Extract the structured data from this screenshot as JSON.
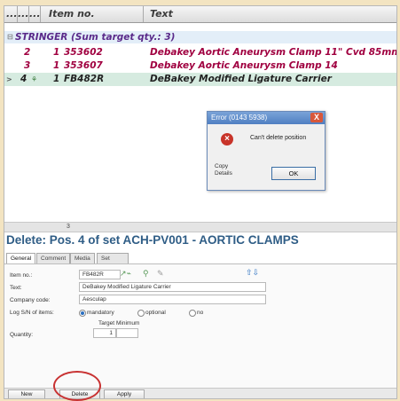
{
  "grid": {
    "headers": [
      "...",
      "...",
      "...",
      "Item no.",
      "Text"
    ],
    "group_label": "STRINGER (Sum target qty.: 3)",
    "rows": [
      {
        "pos": "2",
        "qty": "1",
        "item": "353602",
        "text": "Debakey Aortic Aneurysm Clamp 11\" Cvd 85mm",
        "selected": false
      },
      {
        "pos": "3",
        "qty": "1",
        "item": "353607",
        "text": "Debakey Aortic Aneurysm Clamp 14",
        "selected": false
      },
      {
        "pos": "4",
        "qty": "1",
        "item": "FB482R",
        "text": "DeBakey Modified Ligature Carrier",
        "selected": true
      }
    ],
    "row_marker": ">",
    "footer_value": "3"
  },
  "dialog": {
    "title": "Error (0143 5938)",
    "close_glyph": "X",
    "icon_glyph": "×",
    "message": "Can't delete position",
    "copy_details_1": "Copy",
    "copy_details_2": "Details",
    "ok_label": "OK"
  },
  "panel": {
    "title": "Delete: Pos. 4 of set ACH-PV001 - AORTIC CLAMPS",
    "tabs": [
      "General",
      "Comment",
      "Media",
      "Set positions"
    ],
    "fields": {
      "item_no_label": "Item no.:",
      "item_no_value": "FB482R",
      "text_label": "Text:",
      "text_value": "DeBakey Modified Ligature Carrier",
      "company_code_label": "Company code:",
      "company_code_value": "Aesculap",
      "log_sn_label": "Log S/N of items:",
      "log_sn_options": [
        "mandatory",
        "optional",
        "no"
      ],
      "log_sn_selected": "mandatory",
      "target_label": "Target",
      "minimum_label": "Minimum",
      "quantity_label": "Quantity:",
      "quantity_value": "1"
    },
    "buttons": {
      "new": "New",
      "delete": "Delete",
      "apply": "Apply"
    }
  },
  "colors": {
    "title_blue": "#2f5d86",
    "row_text": "#a00040",
    "selected_row": "#d6ebe0",
    "highlight_circle": "#c83232"
  }
}
